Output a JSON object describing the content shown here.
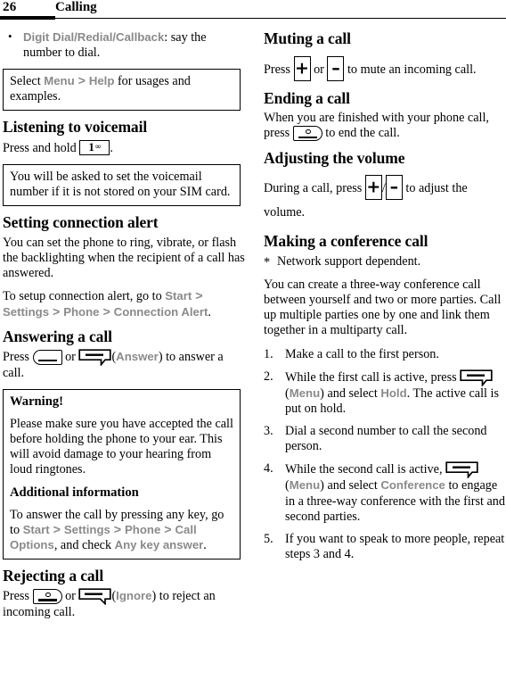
{
  "header": {
    "page_number": "26",
    "chapter_title": "Calling"
  },
  "icons": {
    "send_key": "send-call-key-icon",
    "end_key": "end-call-key-icon",
    "left_softkey": "left-soft-key-icon",
    "right_softkey": "right-soft-key-icon",
    "volume_up": "volume-up-key-icon",
    "volume_down": "volume-down-key-icon",
    "one_key": "number-one-voicemail-key-icon",
    "one_key_digit": "1",
    "one_key_voicemail_mark": "∞",
    "volume_up_glyph": "+",
    "volume_down_glyph": "–"
  },
  "left_column": {
    "bullet_list": [
      {
        "term": "Digit Dial/Redial/Callback",
        "text": ": say the number to dial."
      }
    ],
    "note_help": {
      "part1": "Select ",
      "term1": "Menu",
      "part2": " > ",
      "term2": "Help",
      "part3": " for usages and examples."
    },
    "voicemail": {
      "heading": "Listening to voicemail",
      "press_text_before": "Press and hold ",
      "press_text_after": ".",
      "note": "You will be asked to set the voicemail number if it is not stored on your SIM card."
    },
    "connection_alert": {
      "heading": "Setting connection alert",
      "paragraph1": "You can set the phone to ring, vibrate, or flash the backlighting when the recipient of a call has answered.",
      "p2_before": "To setup connection alert, go to ",
      "p2_term1": "Start",
      "p2_sep1": " > ",
      "p2_term2": "Settings",
      "p2_sep2": " > ",
      "p2_term3": "Phone",
      "p2_sep3": " > ",
      "p2_term4": "Connection Alert",
      "p2_after": "."
    },
    "answering": {
      "heading": "Answering a call",
      "press": "Press ",
      "or": " or ",
      "paren_open": "(",
      "softkey_label": "Answer",
      "paren_close": ")",
      "tail": " to answer a call."
    },
    "warning_box": {
      "title": "Warning!",
      "body": "Please make sure you have accepted the call before holding the phone to your ear. This will avoid damage to your hearing from loud ringtones.",
      "subtitle": "Additional information",
      "info_before": "To answer the call by pressing any key, go to ",
      "info_term1": "Start",
      "info_sep1": " > ",
      "info_term2": "Settings",
      "info_sep2": " > ",
      "info_term3": "Phone",
      "info_sep3": " > ",
      "info_term4": "Call Options",
      "info_mid": ", and check ",
      "info_term5": "Any key answer",
      "info_after": "."
    },
    "rejecting": {
      "heading": "Rejecting a call",
      "press": "Press ",
      "or": " or ",
      "paren_open": "(",
      "softkey_label": "Ignore",
      "paren_close": ")",
      "tail": " to reject an incoming call."
    }
  },
  "right_column": {
    "muting": {
      "heading": "Muting a call",
      "press": "Press ",
      "or": " or ",
      "tail": " to mute an incoming call."
    },
    "ending": {
      "heading": "Ending a call",
      "before": "When you are finished with your phone call, press ",
      "after": " to end the call."
    },
    "volume": {
      "heading": "Adjusting the volume",
      "before": "During a call, press ",
      "slash": "/",
      "after": " to adjust the volume."
    },
    "conference": {
      "heading": "Making a conference call",
      "footnote": "Network support dependent.",
      "intro": "You can create a three-way conference call between yourself and two or more parties. Call up multiple parties one by one and link them together in a multiparty call.",
      "steps": {
        "s1": "Make a call to the first person.",
        "s2_before": "While the first call is active, press ",
        "s2_paren_open": "(",
        "s2_menu": "Menu",
        "s2_paren_close": ")",
        "s2_mid": " and select ",
        "s2_term": "Hold",
        "s2_after": ". The active call is put on hold.",
        "s3": "Dial a second number to call the second person.",
        "s4_before": "While the second call is active, ",
        "s4_paren_open": "(",
        "s4_menu": "Menu",
        "s4_paren_close": ")",
        "s4_mid": " and select ",
        "s4_term": "Conference",
        "s4_after": " to engage in a three-way conference with the first and second parties.",
        "s5": "If you want to speak to more people, repeat steps 3 and 4."
      }
    }
  },
  "colors": {
    "ui_term_gray": "#8a8a8a",
    "text_black": "#000000",
    "page_background": "#ffffff"
  }
}
